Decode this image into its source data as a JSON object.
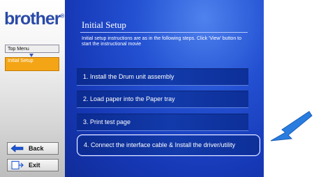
{
  "brand": {
    "name": "brother"
  },
  "sidebar": {
    "nav_top": "Top Menu",
    "nav_current": "Initial Setup",
    "back_label": "Back",
    "exit_label": "Exit"
  },
  "main": {
    "title": "Initial Setup",
    "instructions": "Initial setup instructions are as in the following steps. Click 'View' button to start the instructional movie",
    "steps": [
      "1. Install the Drum unit assembly",
      "2. Load paper into the Paper tray",
      "3. Print test page",
      "4. Connect the interface cable & Install the driver/utility"
    ]
  },
  "colors": {
    "brand": "#2a4aa8",
    "accent": "#f3a516",
    "panel": "#1c46c6",
    "pointer": "#2a7de0"
  },
  "icons": [
    "back-arrow-icon",
    "exit-icon",
    "down-arrow-icon",
    "pointer-arrow-icon"
  ]
}
